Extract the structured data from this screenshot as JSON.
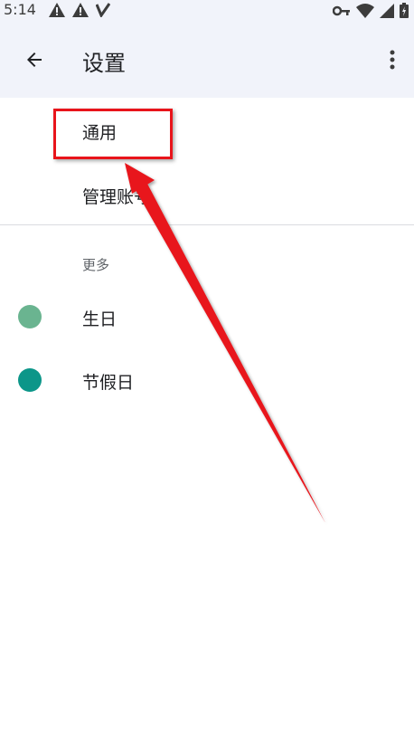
{
  "status_bar": {
    "time": "5:14",
    "left_icons": [
      "warning-icon",
      "warning-icon",
      "check-icon"
    ],
    "right_icons": [
      "key-icon",
      "wifi-icon",
      "signal-icon",
      "battery-icon"
    ]
  },
  "app_bar": {
    "title": "设置",
    "back_icon": "arrow-back-icon",
    "more_icon": "more-vert-icon"
  },
  "menu": {
    "general": "通用",
    "manage_accounts": "管理账号"
  },
  "more_section": {
    "header": "更多",
    "calendars": [
      {
        "label": "生日",
        "color": "#6ab490"
      },
      {
        "label": "节假日",
        "color": "#0c9689"
      }
    ]
  },
  "annotation": {
    "highlight_color": "#e8141b"
  }
}
